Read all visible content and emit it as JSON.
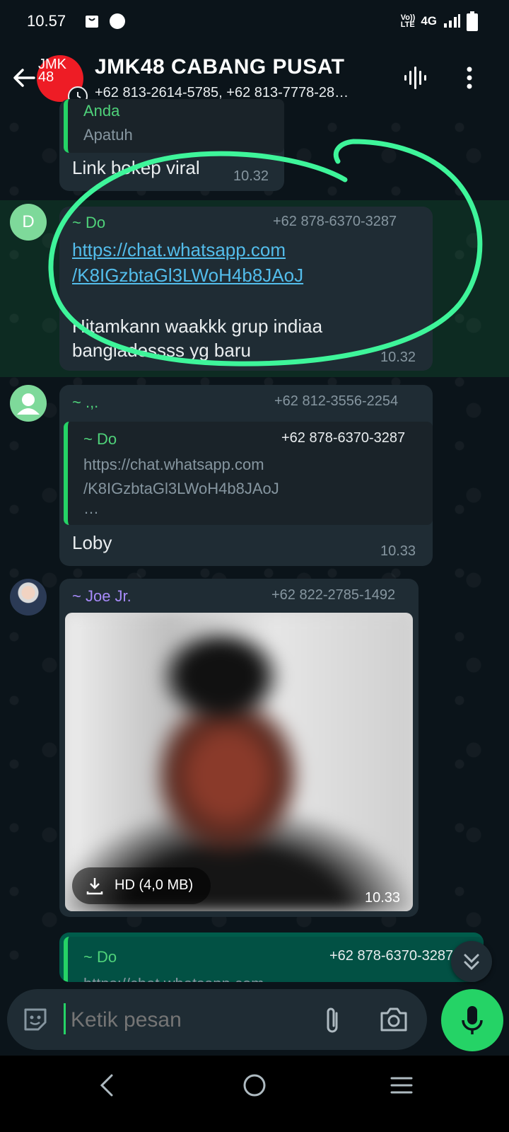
{
  "status_bar": {
    "time": "10.57",
    "network_label": "4G",
    "volte_label": "Vo))\nLTE"
  },
  "header": {
    "title": "JMK48 CABANG PUSAT",
    "members": "+62 813-2614-5785, +62 813-7778-28…",
    "avatar_text": "JMK\n48",
    "avatar_color": "#ee1c25"
  },
  "messages": [
    {
      "quote_sender": "Anda",
      "quote_text": "Apatuh",
      "text": "Link bokep viral",
      "time": "10.32"
    },
    {
      "avatar_letter": "D",
      "sender": "~ Do",
      "phone": "+62 878-6370-3287",
      "link_line1": "https://chat.whatsapp.com",
      "link_line2": "/K8IGzbtaGl3LWoH4b8JAoJ",
      "text_line1": "Hitamkann waakkk grup indiaa",
      "text_line2": "bangladessss yg baru",
      "time": "10.32"
    },
    {
      "sender": "~ .,.",
      "phone": "+62 812-3556-2254",
      "quote_sender": "~ Do",
      "quote_phone": "+62 878-6370-3287",
      "quote_line1": "https://chat.whatsapp.com",
      "quote_line2": "/K8IGzbtaGl3LWoH4b8JAoJ",
      "quote_line3": "…",
      "text": "Loby",
      "time": "10.33"
    },
    {
      "sender": "~ Joe Jr.",
      "phone": "+62 822-2785-1492",
      "download_label": "HD (4,0 MB)",
      "time": "10.33"
    },
    {
      "quote_sender": "~ Do",
      "quote_phone": "+62 878-6370-3287",
      "quote_line1": "https://chat.whatsapp.com"
    }
  ],
  "input": {
    "placeholder": "Ketik pesan"
  },
  "colors": {
    "accent": "#25d366",
    "link": "#53bdeb",
    "sender_do": "#4fd27a",
    "sender_joe": "#a78bfa",
    "bubble": "#1f2c34",
    "background": "#0b141a"
  }
}
